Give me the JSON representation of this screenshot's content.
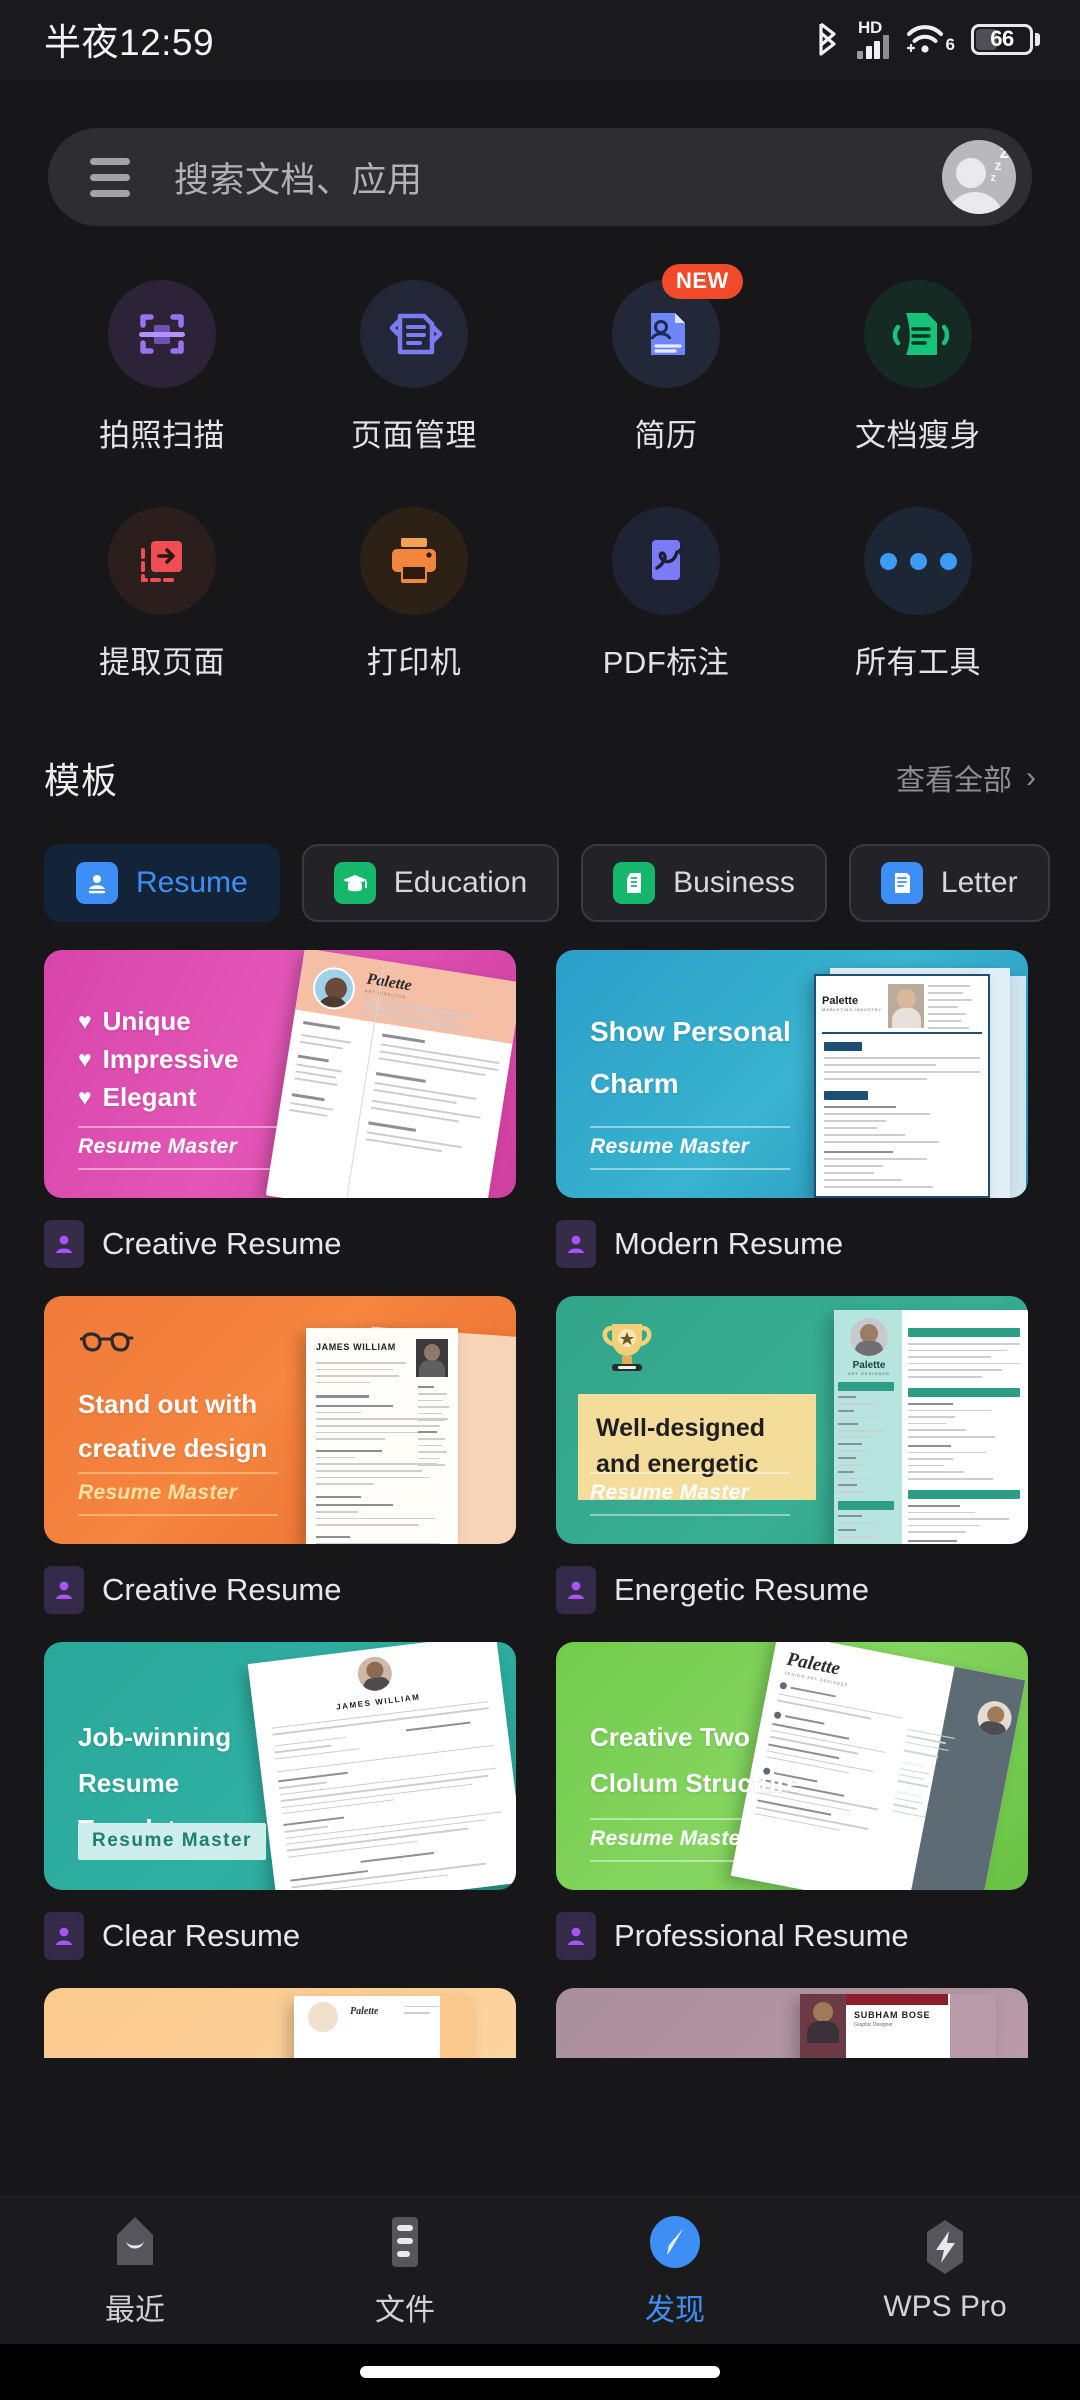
{
  "statusbar": {
    "time": "半夜12:59",
    "hd_label": "HD",
    "wifi_gen": "6",
    "battery_level": "66",
    "icons": [
      "bluetooth-icon",
      "hd-icon",
      "signal-icon",
      "wifi-icon",
      "battery-icon"
    ]
  },
  "search": {
    "placeholder": "搜索文档、应用",
    "menu_icon": "hamburger-icon",
    "avatar_icon": "avatar-sleeping-icon"
  },
  "tools": {
    "row1": [
      {
        "label": "拍照扫描",
        "icon": "camera-scan-icon",
        "circle_bg": "#2c2338",
        "color": "#a07cf0",
        "badge": ""
      },
      {
        "label": "页面管理",
        "icon": "page-manage-icon",
        "circle_bg": "#222636",
        "color": "#7b7cf5",
        "badge": ""
      },
      {
        "label": "简历",
        "icon": "resume-icon",
        "circle_bg": "#232838",
        "color": "#6e86f7",
        "badge": "NEW"
      },
      {
        "label": "文档瘦身",
        "icon": "document-slim-icon",
        "circle_bg": "#142a23",
        "color": "#16c479",
        "badge": ""
      }
    ],
    "row2": [
      {
        "label": "提取页面",
        "icon": "extract-page-icon",
        "circle_bg": "#2d1e1e",
        "color": "#ef4f52",
        "badge": ""
      },
      {
        "label": "打印机",
        "icon": "printer-icon",
        "circle_bg": "#2d2116",
        "color": "#f1863c",
        "badge": ""
      },
      {
        "label": "PDF标注",
        "icon": "pdf-annotate-icon",
        "circle_bg": "#1f2435",
        "color": "#7b7cf5",
        "badge": ""
      },
      {
        "label": "所有工具",
        "icon": "more-dots-icon",
        "circle_bg": "#1d2634",
        "color": "#3d9bf5",
        "badge": ""
      }
    ]
  },
  "templates": {
    "section_title": "模板",
    "see_all": "查看全部",
    "see_all_chevron": "›",
    "chips": [
      {
        "label": "Resume",
        "icon": "resume-chip-icon",
        "icon_bg": "#3d8ef5",
        "active": true
      },
      {
        "label": "Education",
        "icon": "graduation-cap-icon",
        "icon_bg": "#15b86b",
        "active": false
      },
      {
        "label": "Business",
        "icon": "building-icon",
        "icon_bg": "#15b86b",
        "active": false
      },
      {
        "label": "Letter",
        "icon": "letter-doc-icon",
        "icon_bg": "#3d8ef5",
        "active": false
      }
    ],
    "cards": [
      {
        "caption": "Creative Resume",
        "headline_lines": [
          "Unique",
          "Impressive",
          "Elegant"
        ],
        "bullet": "♥",
        "brand": "Resume Master",
        "bg": "linear-gradient(115deg,#d845ab 0%,#e356b7 45%,#cf3f9f 100%)",
        "accent": "#f5c0a8"
      },
      {
        "caption": "Modern Resume",
        "headline_lines": [
          "Show Personal",
          "Charm"
        ],
        "bullet": "",
        "brand": "Resume Master",
        "bg": "linear-gradient(135deg,#2a9ec9 0%,#39b3cf 50%,#2391be 100%)",
        "accent": "#1d4e73"
      },
      {
        "caption": "Creative Resume",
        "headline_lines": [
          "Stand out with",
          "creative design"
        ],
        "bullet": "",
        "brand": "Resume Master",
        "bg": "linear-gradient(135deg,#f0793a 0%,#f5853f 45%,#ea6a2e 100%)",
        "accent": "#2b2b2b",
        "decor": "glasses-icon"
      },
      {
        "caption": "Energetic Resume",
        "headline_lines": [
          "Well-designed",
          "and energetic"
        ],
        "bullet": "",
        "brand": "Resume Master",
        "bg": "linear-gradient(135deg,#32a589 0%,#38ae92 60%,#2d9a80 100%)",
        "accent": "#f4dd9b",
        "decor": "trophy-icon"
      },
      {
        "caption": "Clear Resume",
        "headline_lines": [
          "Job-winning",
          "Resume Template"
        ],
        "bullet": "",
        "brand": "Resume Master",
        "bg": "linear-gradient(135deg,#29a79a 0%,#2fb0a2 55%,#249a8f 100%)",
        "accent": "#cdeeea"
      },
      {
        "caption": "Professional Resume",
        "headline_lines": [
          "Creative Two",
          "Clolum Structure"
        ],
        "bullet": "",
        "brand": "Resume Master",
        "bg": "linear-gradient(135deg,#73cc4e 0%,#84d55f 50%,#69c244 100%)",
        "accent": "#5d6b74"
      },
      {
        "caption": "",
        "headline_lines": [],
        "bullet": "",
        "brand": "",
        "bg": "linear-gradient(135deg,#fbc98e 0%,#fdd49e 100%)",
        "accent": "#ffffff",
        "partial": true
      },
      {
        "caption": "",
        "headline_lines": [],
        "bullet": "",
        "brand": "",
        "bg": "linear-gradient(135deg,#a98e9c 0%,#b99aa7 100%)",
        "accent": "#8e1d2c",
        "partial": true,
        "peek_name": "SUBHAM BOSE"
      }
    ],
    "card_paper_name_1": "Palette",
    "card_paper_name_3": "JAMES WILLIAM",
    "card_paper_name_5": "JAMES WILLIAM"
  },
  "bottomnav": [
    {
      "label": "最近",
      "icon": "recent-icon",
      "active": false
    },
    {
      "label": "文件",
      "icon": "files-icon",
      "active": false
    },
    {
      "label": "发现",
      "icon": "compass-discover-icon",
      "active": true
    },
    {
      "label": "WPS Pro",
      "icon": "lightning-pro-icon",
      "active": false
    }
  ],
  "colors": {
    "page_bg": "#17171a",
    "accent_blue": "#3d8ef5",
    "badge_red": "#f04a2a",
    "nav_inactive": "#d2d2d6"
  }
}
